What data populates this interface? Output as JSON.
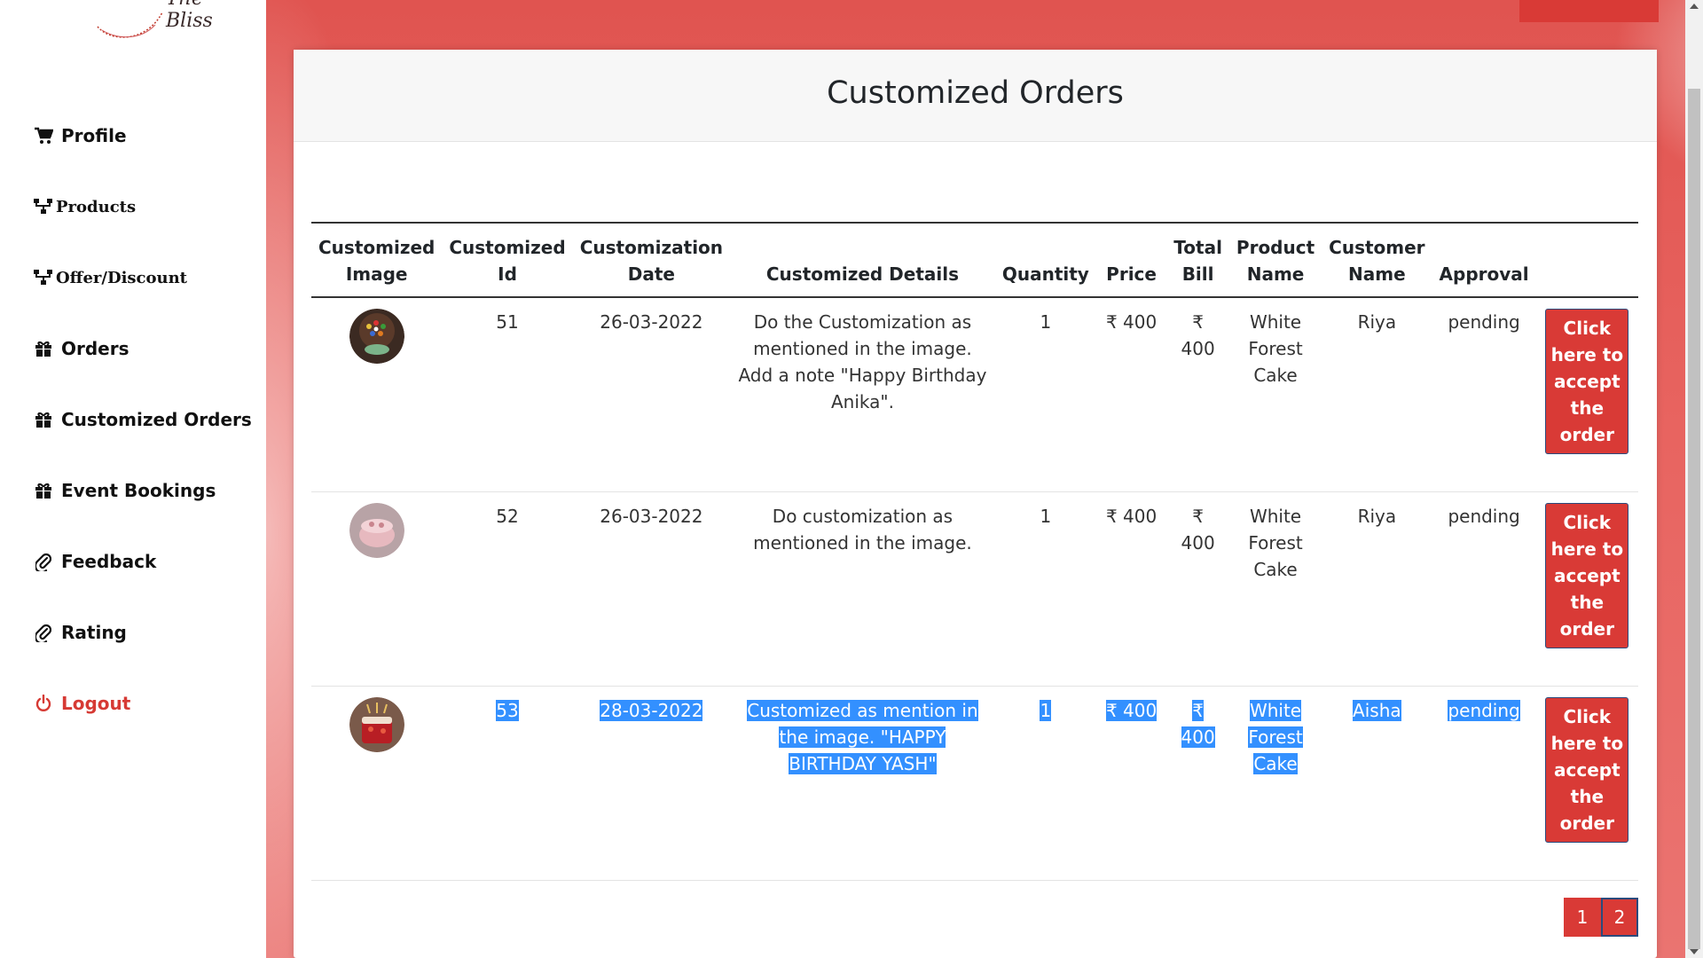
{
  "brand": {
    "logo_text": "The Bliss"
  },
  "sidebar": {
    "items": [
      {
        "label": "Profile",
        "icon": "cart-icon"
      },
      {
        "label": "Products",
        "icon": "sitemap-icon"
      },
      {
        "label": "Offer/Discount",
        "icon": "sitemap-icon"
      },
      {
        "label": "Orders",
        "icon": "gift-icon"
      },
      {
        "label": "Customized Orders",
        "icon": "gift-icon"
      },
      {
        "label": "Event Bookings",
        "icon": "gift-icon"
      },
      {
        "label": "Feedback",
        "icon": "paperclip-icon"
      },
      {
        "label": "Rating",
        "icon": "paperclip-icon"
      },
      {
        "label": "Logout",
        "icon": "power-icon"
      }
    ]
  },
  "page": {
    "title": "Customized Orders"
  },
  "table": {
    "headers": {
      "image": [
        "Customized",
        "Image"
      ],
      "id": [
        "Customized",
        "Id"
      ],
      "date": [
        "Customization",
        "Date"
      ],
      "details": "Customized Details",
      "quantity": "Quantity",
      "price": "Price",
      "total": [
        "Total",
        "Bill"
      ],
      "product": [
        "Product",
        "Name"
      ],
      "customer": [
        "Customer",
        "Name"
      ],
      "approval": "Approval"
    },
    "rows": [
      {
        "id": "51",
        "date": "26-03-2022",
        "details": "Do the Customization as mentioned in the image. Add a note \"Happy Birthday Anika\".",
        "quantity": "1",
        "price": "₹ 400",
        "total": "₹ 400",
        "product": "White Forest Cake",
        "customer": "Riya",
        "approval": "pending",
        "action": "Click here to accept the order",
        "image_desc": "chocolate-gems-cake"
      },
      {
        "id": "52",
        "date": "26-03-2022",
        "details": "Do customization as mentioned in the image.",
        "quantity": "1",
        "price": "₹ 400",
        "total": "₹ 400",
        "product": "White Forest Cake",
        "customer": "Riya",
        "approval": "pending",
        "action": "Click here to accept the order",
        "image_desc": "pink-cake"
      },
      {
        "id": "53",
        "date": "28-03-2022",
        "details": "Customized as mention in the image. \"HAPPY BIRTHDAY YASH\"",
        "quantity": "1",
        "price": "₹ 400",
        "total": "₹ 400",
        "product": "White Forest Cake",
        "customer": "Aisha",
        "approval": "pending",
        "action": "Click here to accept the order",
        "image_desc": "red-drip-cake"
      }
    ]
  },
  "pagination": {
    "pages": [
      "1",
      "2"
    ],
    "active": "2"
  },
  "colors": {
    "accent": "#d93a36",
    "selection": "#3390ff",
    "gradient": "#e05450"
  }
}
